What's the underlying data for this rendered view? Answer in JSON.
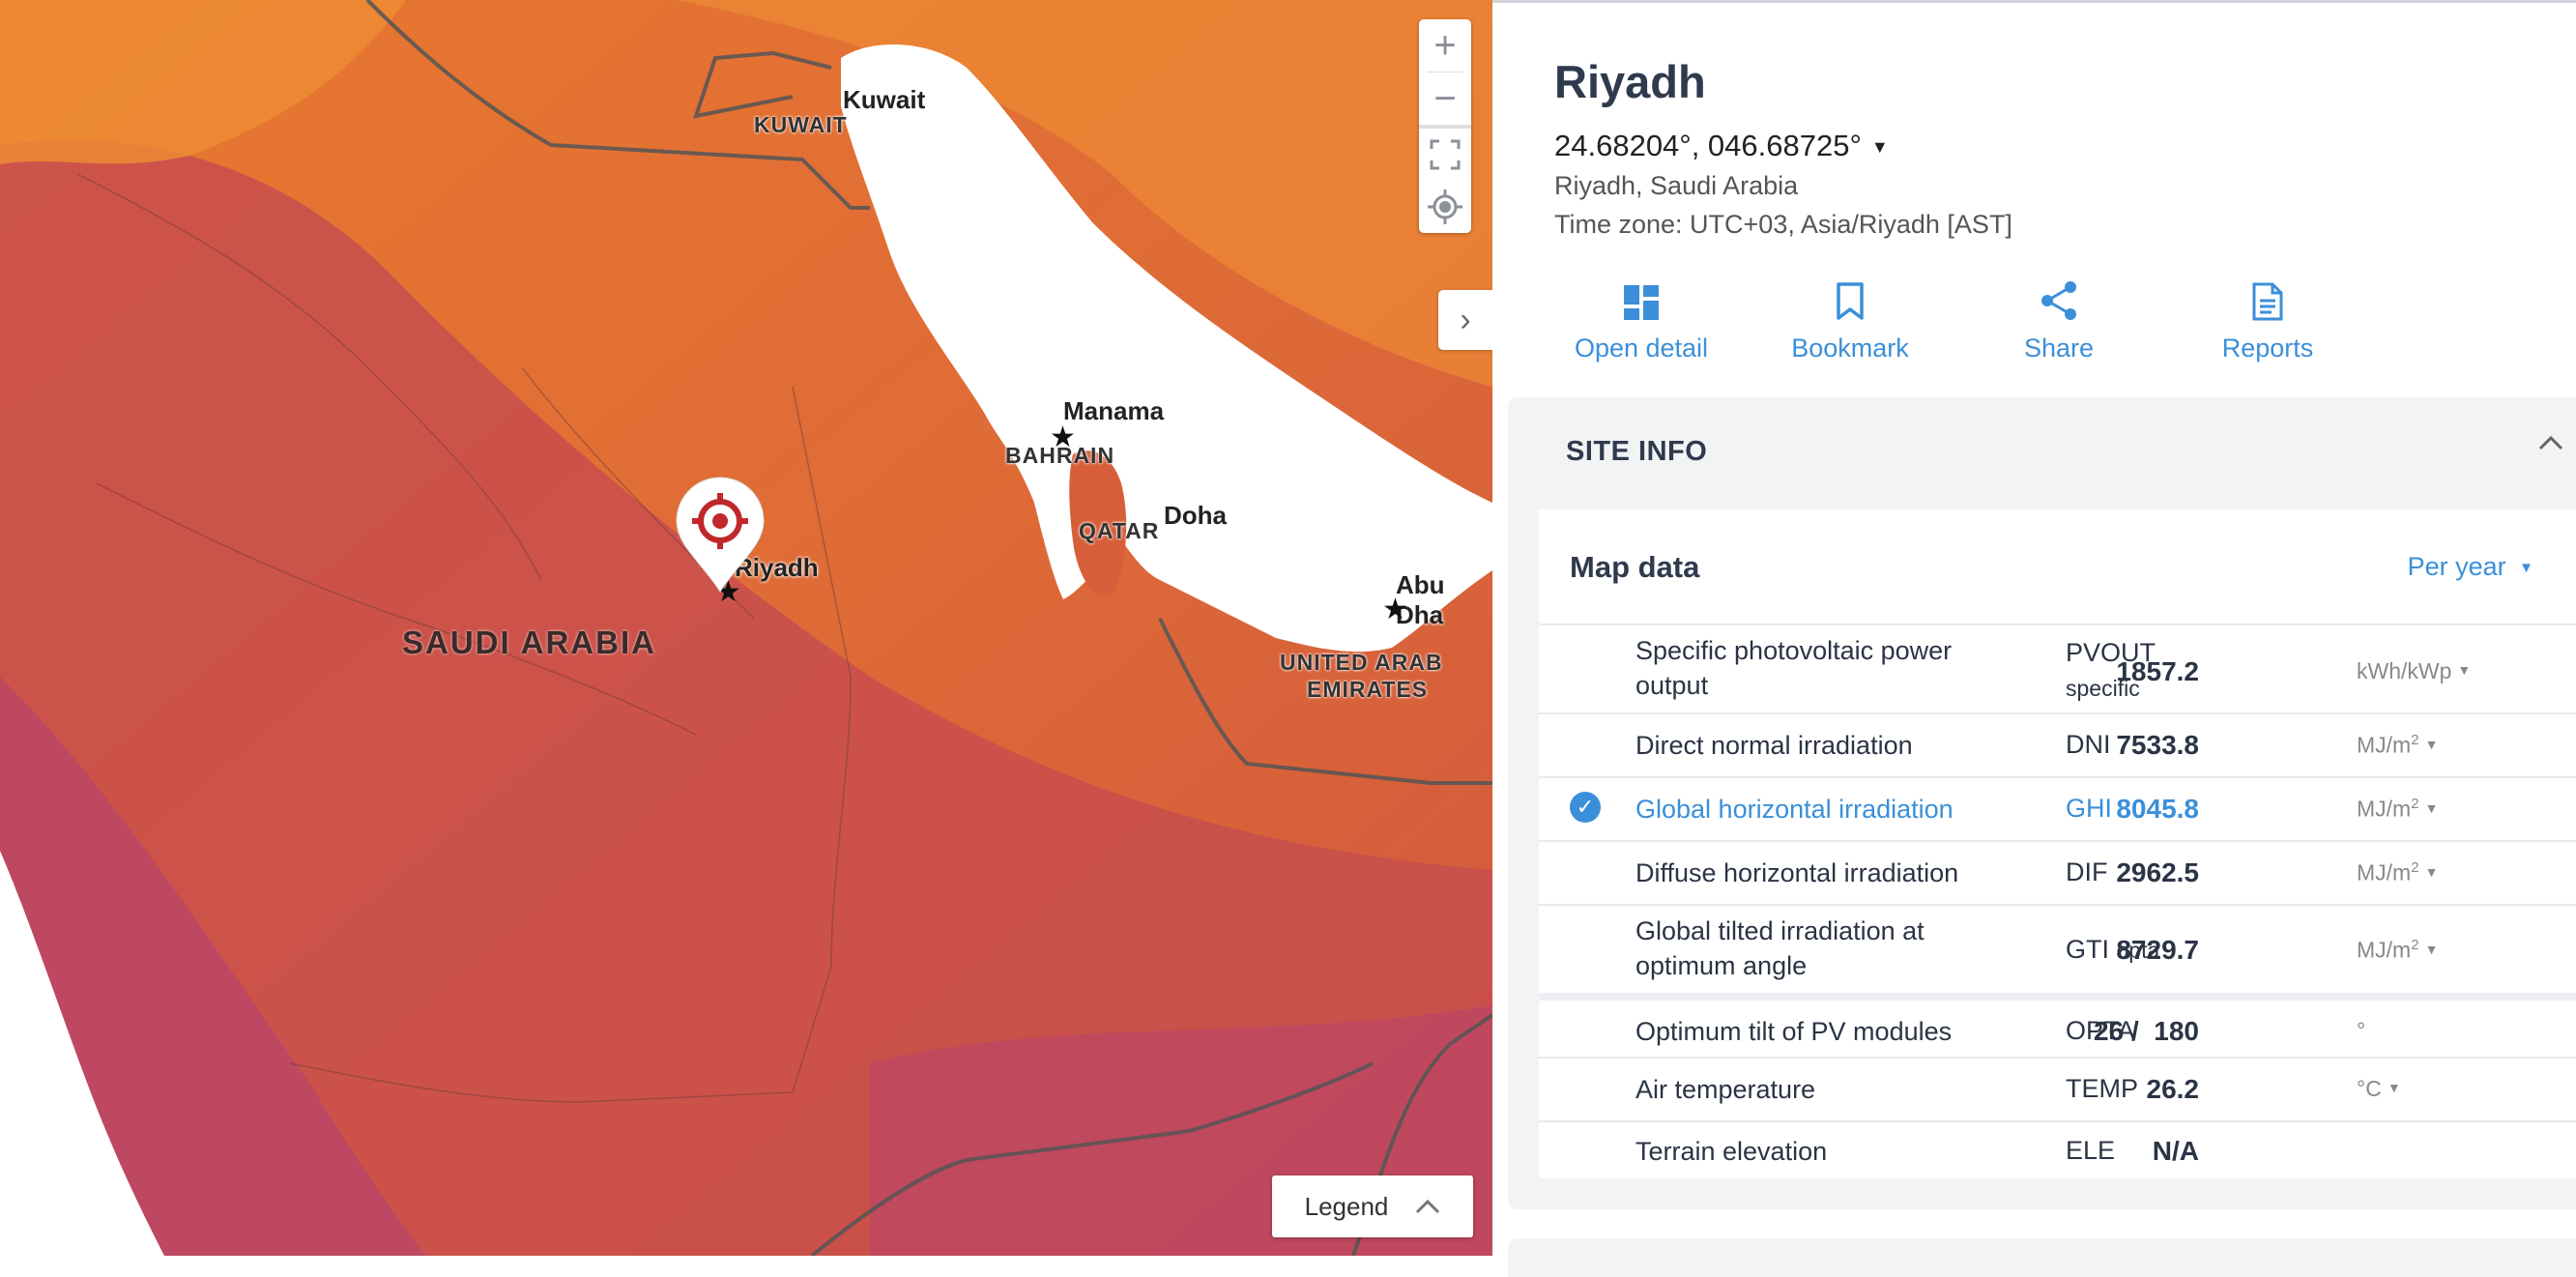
{
  "map": {
    "labels": {
      "kuwait_city": "Kuwait",
      "kuwait_country": "KUWAIT",
      "manama": "Manama",
      "bahrain": "BAHRAIN",
      "qatar": "QATAR",
      "doha": "Doha",
      "riyadh": "Riyadh",
      "saudi_arabia": "SAUDI ARABIA",
      "abu_dhabi": "Abu Dha",
      "uae_line1": "UNITED ARAB",
      "uae_line2": "EMIRATES"
    },
    "zoom_in": "+",
    "zoom_out": "−",
    "legend_label": "Legend",
    "colors": {
      "high": "#c14a5a",
      "mid": "#d8653b",
      "low": "#ec8a33",
      "water": "#ffffff",
      "marker": "#c0282c"
    }
  },
  "site": {
    "title": "Riyadh",
    "coordinates": "24.68204°, 046.68725°",
    "place": "Riyadh, Saudi Arabia",
    "timezone": "Time zone: UTC+03, Asia/Riyadh [AST]"
  },
  "actions": [
    {
      "label": "Open detail",
      "icon": "dashboard-icon"
    },
    {
      "label": "Bookmark",
      "icon": "bookmark-icon"
    },
    {
      "label": "Share",
      "icon": "share-icon"
    },
    {
      "label": "Reports",
      "icon": "document-icon"
    }
  ],
  "site_info": {
    "heading": "SITE INFO",
    "map_data_title": "Map data",
    "period": "Per year",
    "rows": [
      {
        "name_l1": "Specific photovoltaic power",
        "name_l2": "output",
        "abbr": "PVOUT",
        "abbr_sub": "specific",
        "value": "1857.2",
        "unit": "kWh/kWp",
        "unit_sup": ""
      },
      {
        "name_l1": "Direct normal irradiation",
        "name_l2": "",
        "abbr": "DNI",
        "abbr_sub": "",
        "value": "7533.8",
        "unit": "MJ/m",
        "unit_sup": "2"
      },
      {
        "name_l1": "Global horizontal irradiation",
        "name_l2": "",
        "abbr": "GHI",
        "abbr_sub": "",
        "value": "8045.8",
        "unit": "MJ/m",
        "unit_sup": "2"
      },
      {
        "name_l1": "Diffuse horizontal irradiation",
        "name_l2": "",
        "abbr": "DIF",
        "abbr_sub": "",
        "value": "2962.5",
        "unit": "MJ/m",
        "unit_sup": "2"
      },
      {
        "name_l1": "Global tilted irradiation at",
        "name_l2": "optimum angle",
        "abbr": "GTI",
        "abbr_sub": "opta",
        "value": "8729.7",
        "unit": "MJ/m",
        "unit_sup": "2"
      },
      {
        "name_l1": "Optimum tilt of PV modules",
        "name_l2": "",
        "abbr": "OPTA",
        "abbr_sub": "",
        "value": "26 /  180",
        "unit": "°",
        "unit_sup": ""
      },
      {
        "name_l1": "Air temperature",
        "name_l2": "",
        "abbr": "TEMP",
        "abbr_sub": "",
        "value": "26.2",
        "unit": "°C",
        "unit_sup": ""
      },
      {
        "name_l1": "Terrain elevation",
        "name_l2": "",
        "abbr": "ELE",
        "abbr_sub": "",
        "value": "N/A",
        "unit": "",
        "unit_sup": ""
      }
    ]
  }
}
